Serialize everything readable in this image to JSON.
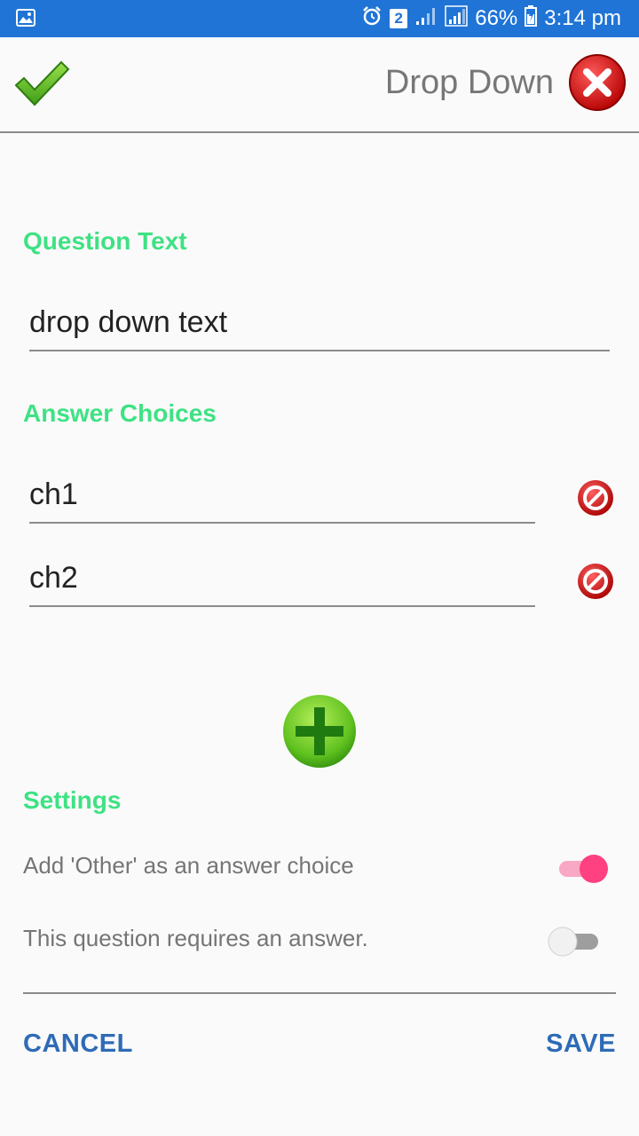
{
  "status_bar": {
    "notification_icon": "image-icon",
    "alarm_icon": "alarm-icon",
    "sim_badge": "2",
    "battery": "66%",
    "time": "3:14 pm"
  },
  "header": {
    "confirm_icon": "check-icon",
    "title": "Drop Down",
    "close_icon": "close-icon"
  },
  "question": {
    "label": "Question Text",
    "value": "drop down text"
  },
  "answers": {
    "label": "Answer Choices",
    "choices": [
      "ch1",
      "ch2"
    ],
    "delete_icon": "delete-icon",
    "add_icon": "add-icon"
  },
  "settings": {
    "label": "Settings",
    "other_label": "Add 'Other' as an answer choice",
    "other_enabled": true,
    "required_label": "This question requires an answer.",
    "required_enabled": false
  },
  "footer": {
    "cancel": "CANCEL",
    "save": "SAVE"
  },
  "colors": {
    "status_bar": "#1f74d6",
    "section_label": "#3ee283",
    "toggle_on": "#ff4081",
    "button_text": "#2e6bb6"
  }
}
